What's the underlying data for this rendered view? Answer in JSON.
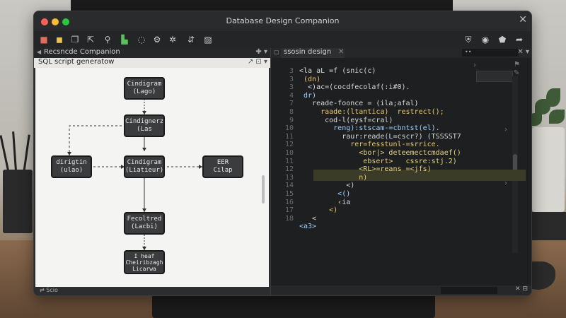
{
  "window": {
    "title": "Database Design Companion"
  },
  "toolbar": {
    "icons": [
      "layers-icon",
      "database-icon",
      "copy-icon",
      "export-icon",
      "search-icon",
      "chart-icon",
      "refresh-icon",
      "settings-icon",
      "puzzle-icon",
      "share-icon",
      "image-icon",
      "shield-icon",
      "clock-icon",
      "tag-icon",
      "forward-icon"
    ]
  },
  "left_panel": {
    "header": "Recsncde Companion",
    "subheader": "SQL script generatow",
    "footer": "Scio"
  },
  "diagram": {
    "nodes": [
      {
        "id": "n1",
        "lines": [
          "Cindigram",
          "(Lago)"
        ]
      },
      {
        "id": "n2",
        "lines": [
          "Cindignerz",
          "(Las"
        ]
      },
      {
        "id": "n3",
        "lines": [
          "dirigtin",
          "(ulao)"
        ]
      },
      {
        "id": "n4",
        "lines": [
          "Cindigram",
          "(Liatieur)"
        ]
      },
      {
        "id": "n5",
        "lines": [
          "EER",
          "Cilap"
        ]
      },
      {
        "id": "n6",
        "lines": [
          "Fecoltred",
          "(Lacbi)"
        ]
      },
      {
        "id": "n7",
        "lines": [
          "I heaf",
          "Cheiribzagh",
          "Licarwa"
        ]
      }
    ]
  },
  "editor": {
    "tab_label": "ssosin design",
    "lines": [
      {
        "n": "3",
        "text": "<la aL =f (snic(c)"
      },
      {
        "n": "3",
        "text": " (dn)"
      },
      {
        "n": "3",
        "text": "  <)ac=(cocdfecolaf(:i#0)."
      },
      {
        "n": "4",
        "text": " dr)"
      },
      {
        "n": "7",
        "text": "   reade-foonce = (ila;afal)"
      },
      {
        "n": "8",
        "text": "     raade:(ltantica)  restrect();"
      },
      {
        "n": "9",
        "text": "      cod-l(eysf=cral)"
      },
      {
        "n": "10",
        "text": "        reng):stscam-=cbntst(el)."
      },
      {
        "n": "11",
        "text": "          raur:reade(L=cscr?) (TSSSST7"
      },
      {
        "n": "12",
        "text": "            rer=fesstunl-=srrice."
      },
      {
        "n": "10",
        "text": "              <bor|> deteemectcmdaef()"
      },
      {
        "n": "11",
        "text": "               ebsert>   cssre:stj.2)"
      },
      {
        "n": "12",
        "text": "              <RL>=reans =<jfs)"
      },
      {
        "n": "13",
        "text": "              n)"
      },
      {
        "n": "14",
        "text": "           <)"
      },
      {
        "n": "15",
        "text": "         <()"
      },
      {
        "n": "16",
        "text": "         ‹ia"
      },
      {
        "n": "17",
        "text": "       <)"
      },
      {
        "n": "18",
        "text": "   <"
      },
      {
        "n": "",
        "text": "<a3>"
      }
    ]
  },
  "colors": {
    "accent_highlight": "#3a3c27",
    "string": "#e8c76a",
    "keyword": "#9fd0ff"
  }
}
